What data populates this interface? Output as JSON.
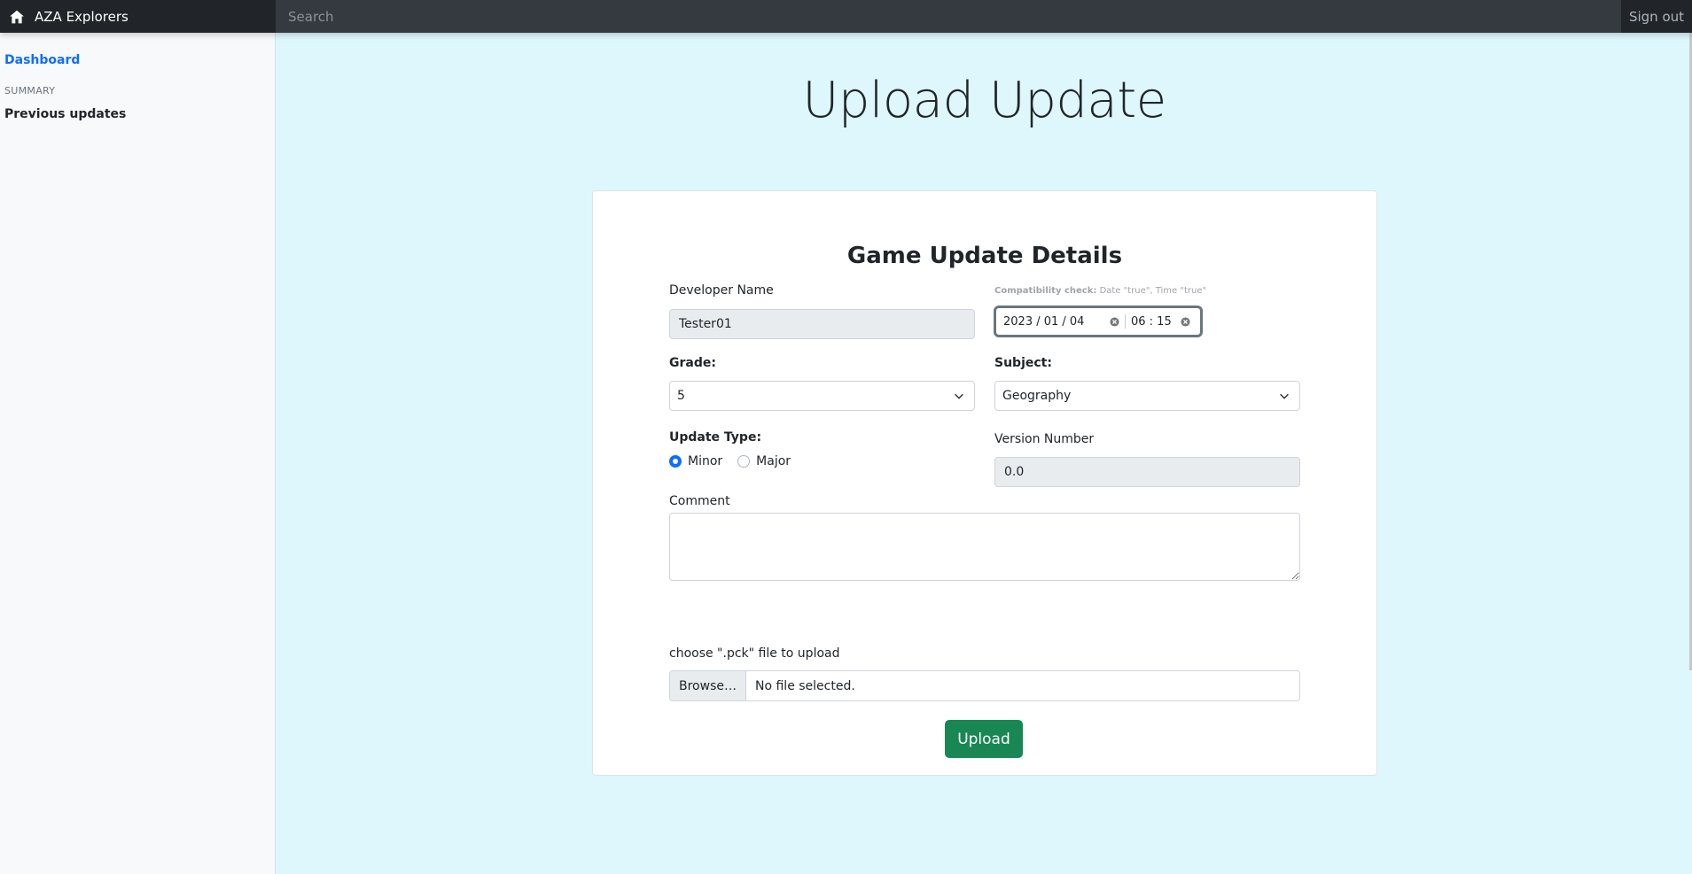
{
  "navbar": {
    "brand": "AZA Explorers",
    "search_placeholder": "Search",
    "signout": "Sign out"
  },
  "sidebar": {
    "dashboard": "Dashboard",
    "summary_heading": "SUMMARY",
    "previous_updates": "Previous updates"
  },
  "page": {
    "title": "Upload Update"
  },
  "form": {
    "card_title": "Game Update Details",
    "developer_label": "Developer Name",
    "developer_value": "Tester01",
    "compat_label": "Compatibility check:",
    "compat_text": "Date \"true\", Time \"true\"",
    "date_value": "2023 / 01 / 04",
    "time_value": "06 : 15",
    "grade_label": "Grade:",
    "grade_value": "5",
    "subject_label": "Subject:",
    "subject_value": "Geography",
    "update_type_label": "Update Type:",
    "update_type_options": [
      "Minor",
      "Major"
    ],
    "update_type_selected": "Minor",
    "version_label": "Version Number",
    "version_value": "0.0",
    "comment_label": "Comment",
    "comment_value": "",
    "file_label": "choose \".pck\" file to upload",
    "browse_label": "Browse…",
    "file_status": "No file selected.",
    "upload_label": "Upload"
  },
  "colors": {
    "primary": "#0d6efd",
    "success": "#198754",
    "page_bg": "#ddf7fd",
    "navbar": "#343a40"
  }
}
